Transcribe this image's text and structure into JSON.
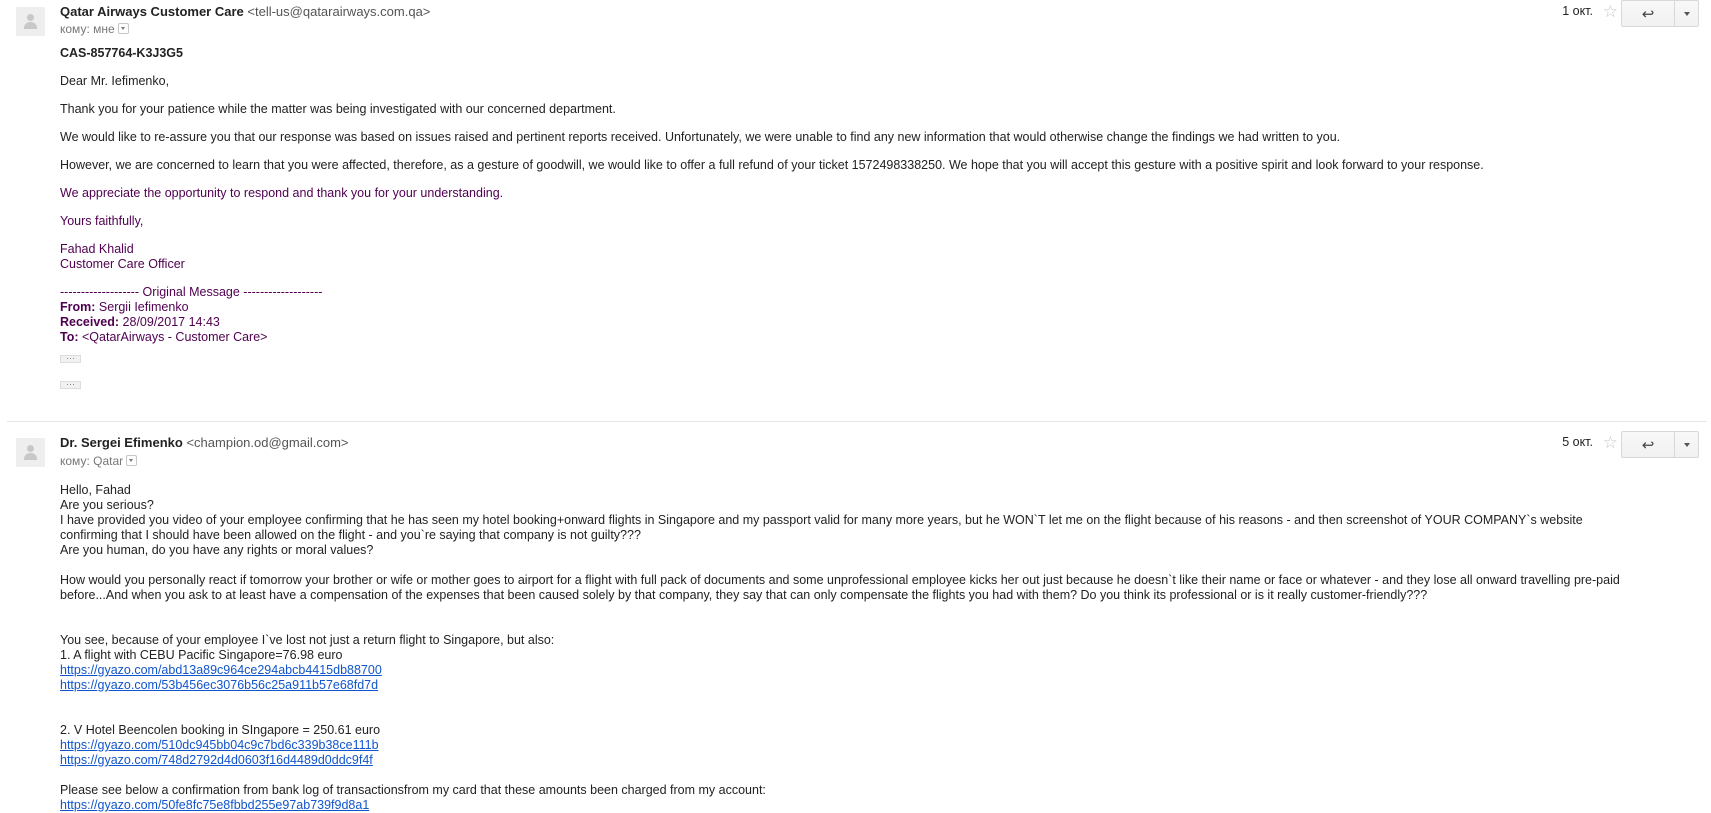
{
  "messages": [
    {
      "sender_name": "Qatar Airways Customer Care",
      "sender_email": "<tell-us@qatarairways.com.qa>",
      "recipient_line": "кому: мне",
      "date": "1 окт.",
      "case_id": "CAS-857764-K3J3G5",
      "greeting": "Dear Mr. Iefimenko,",
      "paragraphs": [
        "Thank you for your patience while the matter was being investigated with our concerned department.",
        "We would like to re-assure you that our response was based on issues raised and pertinent reports received. Unfortunately, we were unable to find any new information that would otherwise change the findings we had written to you.",
        "However, we are concerned to learn that you were affected, therefore, as a gesture of goodwill, we would like to offer a full refund of your ticket 1572498338250. We hope that you will accept this gesture with a positive spirit and look forward to your response."
      ],
      "appreciation": "We appreciate the opportunity to respond and thank you for your understanding.",
      "closing": "Yours faithfully,",
      "signature_name": "Fahad Khalid",
      "signature_title": "Customer Care Officer",
      "original": {
        "header": "------------------- Original Message -------------------",
        "from_label": "From:",
        "from_value": "Sergii Iefimenko",
        "received_label": "Received:",
        "received_value": "28/09/2017 14:43",
        "to_label": "To:",
        "to_value": "<QatarAirways - Customer Care>"
      }
    },
    {
      "sender_name": "Dr. Sergei Efimenko",
      "sender_email": "<champion.od@gmail.com>",
      "recipient_line": "кому: Qatar",
      "date": "5 окт.",
      "lines": [
        "Hello, Fahad",
        "Are you serious?",
        "I have provided you video of your employee confirming that he has seen my hotel booking+onward flights in Singapore and my passport valid for many more years, but he WON`T let me on the flight because of his reasons - and then screenshot of YOUR COMPANY`s website",
        "confirming that I should have been allowed on the flight - and you`re saying that company is not guilty???",
        "Are you human, do you have any rights or moral values?"
      ],
      "para2": [
        "How would you personally react if tomorrow your brother or wife or mother goes to airport for a flight with full pack of documents and some unprofessional employee kicks her out just because he doesn`t like their name or face or whatever - and they lose all onward travelling pre-paid",
        "before...And when you ask to at least have a compensation of the expenses that been caused solely by that company, they say that can only compensate the flights you had with them? Do you think its professional or is it really customer-friendly???"
      ],
      "losses_intro": "You see, because of your employee I`ve lost not just a return flight to Singapore, but also:",
      "item1": "1. A flight with CEBU Pacific Singapore=76.98 euro",
      "item1_links": [
        "https://gyazo.com/abd13a89c964ce294abcb4415db88700",
        "https://gyazo.com/53b456ec3076b56c25a911b57e68fd7d"
      ],
      "item2": "2. V Hotel Beencolen booking in SIngapore = 250.61 euro",
      "item2_links": [
        "https://gyazo.com/510dc945bb04c9c7bd6c339b38ce111b",
        "https://gyazo.com/748d2792d4d0603f16d4489d0ddc9f4f"
      ],
      "bank_text": "Please see below a confirmation from bank log of transactionsfrom my card that these amounts been charged from my account:",
      "bank_link": "https://gyazo.com/50fe8fc75e8fbbd255e97ab739f9d8a1"
    }
  ],
  "icons": {
    "avatar": "person-avatar-icon",
    "star": "star-icon",
    "reply": "reply-icon",
    "more": "chevron-down-icon"
  },
  "colors": {
    "link": "#1155cc",
    "quoted_purple": "#500050"
  }
}
